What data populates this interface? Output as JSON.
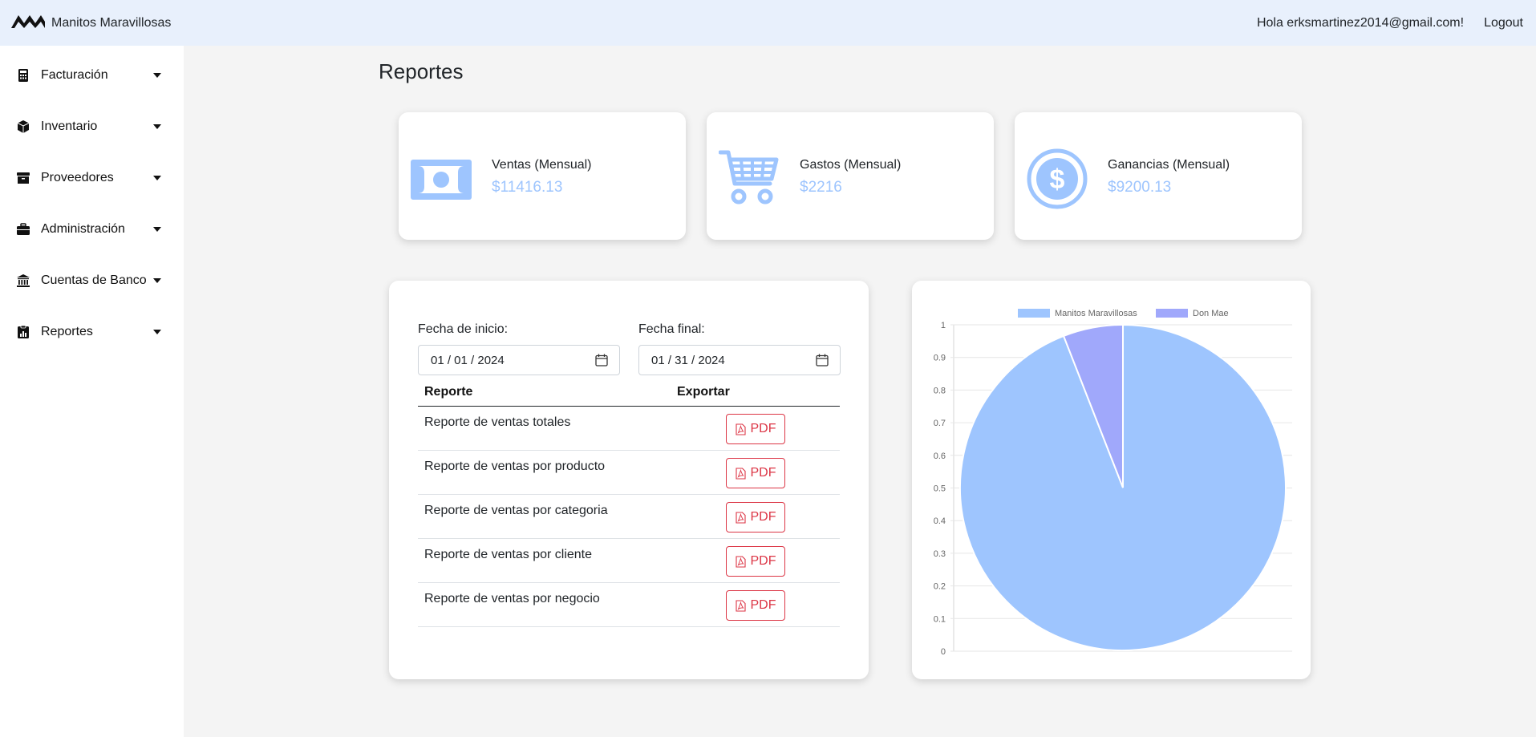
{
  "navbar": {
    "brand_name": "Manitos Maravillosas",
    "greeting": "Hola erksmartinez2014@gmail.com!",
    "logout": "Logout"
  },
  "sidebar": {
    "items": [
      {
        "label": "Facturación",
        "icon": "calculator-icon"
      },
      {
        "label": "Inventario",
        "icon": "box-icon"
      },
      {
        "label": "Proveedores",
        "icon": "archive-icon"
      },
      {
        "label": "Administración",
        "icon": "briefcase-icon"
      },
      {
        "label": "Cuentas de Banco",
        "icon": "bank-icon"
      },
      {
        "label": "Reportes",
        "icon": "report-icon"
      }
    ]
  },
  "main": {
    "title": "Reportes",
    "stats": [
      {
        "label": "Ventas (Mensual)",
        "value": "$11416.13",
        "icon": "money-bill-icon"
      },
      {
        "label": "Gastos (Mensual)",
        "value": "$2216",
        "icon": "cart-icon"
      },
      {
        "label": "Ganancias (Mensual)",
        "value": "$9200.13",
        "icon": "dollar-circle-icon"
      }
    ],
    "accent_color": "#9ec5fe",
    "form": {
      "start_label": "Fecha de inicio:",
      "start_value": "01 / 01 / 2024",
      "end_label": "Fecha final:",
      "end_value": "01 / 31 / 2024"
    },
    "table": {
      "headers": [
        "Reporte",
        "Exportar"
      ],
      "rows": [
        "Reporte de ventas totales",
        "Reporte de ventas por producto",
        "Reporte de ventas por categoria",
        "Reporte de ventas por cliente",
        "Reporte de ventas por negocio"
      ],
      "button_label": "PDF",
      "button_color": "#dc3545"
    }
  },
  "chart_data": {
    "type": "pie",
    "series": [
      {
        "name": "Manitos Maravillosas",
        "value": 11416.13,
        "color": "#9ec5fe"
      },
      {
        "name": "Don Mae",
        "value": 720,
        "color": "#a0a8fb"
      }
    ],
    "y_ticks": [
      "0",
      "0.1",
      "0.2",
      "0.3",
      "0.4",
      "0.5",
      "0.6",
      "0.7",
      "0.8",
      "0.9",
      "1"
    ],
    "legend_position": "top",
    "grid": true
  }
}
